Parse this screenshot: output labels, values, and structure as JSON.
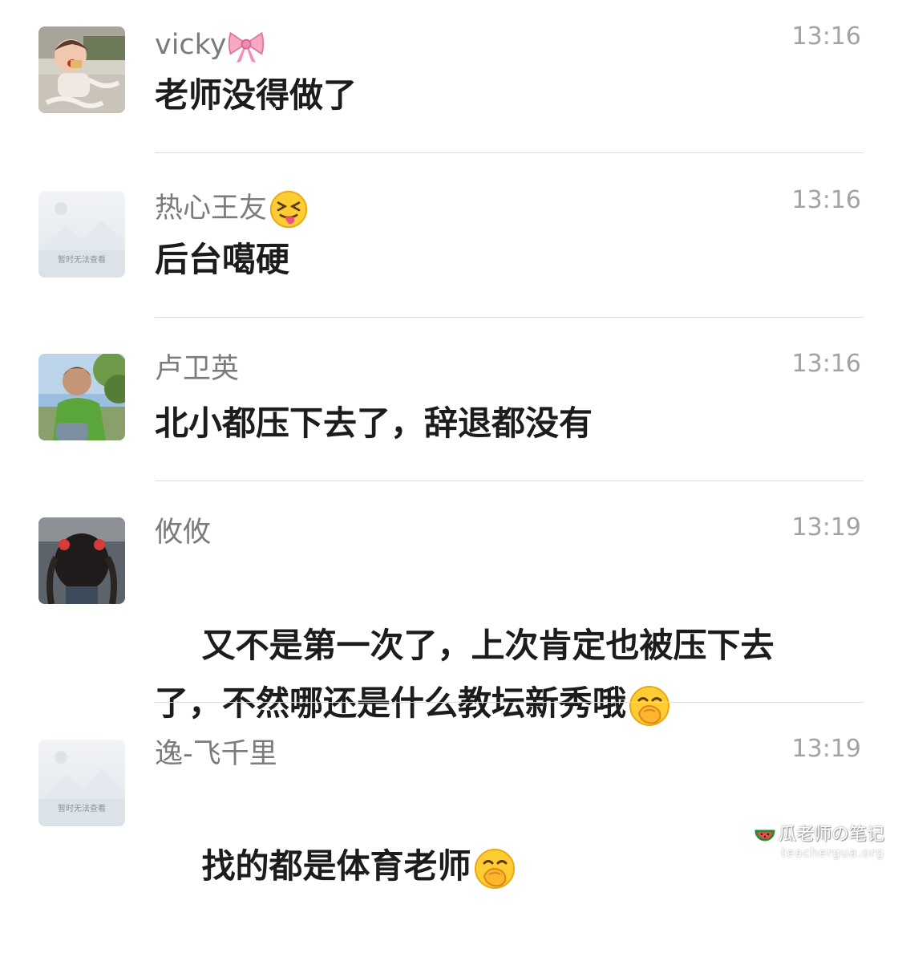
{
  "comments": [
    {
      "name": "vicky",
      "name_emoji": "bow-icon",
      "time": "13:16",
      "text": "老师没得做了",
      "avatar": "photo-child-eating"
    },
    {
      "name": "热心王友",
      "name_emoji": "squinting-tongue-emoji",
      "time": "13:16",
      "text": "后台噶硬",
      "avatar": "placeholder-image",
      "avatar_caption": "暂时无法查看"
    },
    {
      "name": "卢卫英",
      "time": "13:16",
      "text": "北小都压下去了，辞退都没有",
      "avatar": "photo-boy-outdoors"
    },
    {
      "name": "攸攸",
      "time": "13:19",
      "text_line1": "又不是第一次了，上次肯定也被压下去",
      "text_line2": "了，不然哪还是什么教坛新秀哦",
      "text_emoji": "hand-over-mouth-emoji",
      "avatar": "photo-girl-braids"
    },
    {
      "name": "逸-飞千里",
      "time": "13:19",
      "text": "找的都是体育老师",
      "text_emoji": "hand-over-mouth-emoji",
      "avatar": "placeholder-image",
      "avatar_caption": "暂时无法查看"
    }
  ],
  "watermark": {
    "line1": "瓜老师の笔记",
    "line2": "teachergua.org",
    "icon": "watermelon-icon"
  }
}
